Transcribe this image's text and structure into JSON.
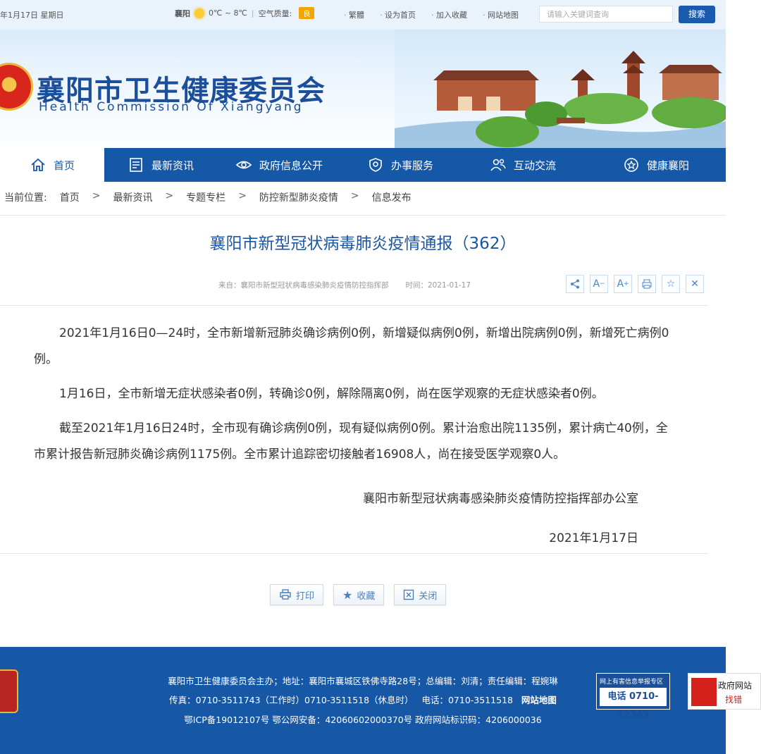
{
  "topbar": {
    "date": "年1月17日 星期日",
    "city": "襄阳",
    "temperature": "0℃ ~ 8℃",
    "air_quality_label": "空气质量:",
    "air_quality_value": "良",
    "links": [
      "繁體",
      "设为首页",
      "加入收藏",
      "网站地图"
    ],
    "search_placeholder": "请输入关键词查询",
    "search_button": "搜索"
  },
  "header": {
    "site_name_cn": "襄阳市卫生健康委员会",
    "site_name_en": "Health Commission Of Xiangyang"
  },
  "nav": {
    "items": [
      {
        "label": "首页",
        "icon": "home-icon"
      },
      {
        "label": "最新资讯",
        "icon": "news-icon"
      },
      {
        "label": "政府信息公开",
        "icon": "eye-icon"
      },
      {
        "label": "办事服务",
        "icon": "shield-icon"
      },
      {
        "label": "互动交流",
        "icon": "people-icon"
      },
      {
        "label": "健康襄阳",
        "icon": "star-badge-icon"
      }
    ]
  },
  "breadcrumb": {
    "label": "当前位置:",
    "items": [
      "首页",
      "最新资讯",
      "专题专栏",
      "防控新型肺炎疫情",
      "信息发布"
    ],
    "separator": ">"
  },
  "article": {
    "title": "襄阳市新型冠状病毒肺炎疫情通报（362）",
    "source": "来自：襄阳市新型冠状病毒感染肺炎疫情防控指挥部",
    "time": "时间：2021-01-17",
    "paragraphs": [
      "2021年1月16日0—24时，全市新增新冠肺炎确诊病例0例，新增疑似病例0例，新增出院病例0例，新增死亡病例0例。",
      "1月16日，全市新增无症状感染者0例，转确诊0例，解除隔离0例，尚在医学观察的无症状感染者0例。",
      "截至2021年1月16日24时，全市现有确诊病例0例，现有疑似病例0例。累计治愈出院1135例，累计病亡40例，全市累计报告新冠肺炎确诊病例1175例。全市累计追踪密切接触者16908人，尚在接受医学观察0人。"
    ],
    "signature": "襄阳市新型冠状病毒感染肺炎疫情防控指挥部办公室",
    "date": "2021年1月17日"
  },
  "tools": [
    "share-icon",
    "font-decrease-icon",
    "font-increase-icon",
    "print-icon",
    "favorite-icon",
    "close-icon"
  ],
  "actions": {
    "print": "打印",
    "favorite": "收藏",
    "close": "关闭"
  },
  "footer": {
    "line1": "襄阳市卫生健康委员会主办；地址：襄阳市襄城区铁佛寺路28号；总编辑：刘清；责任编辑：程婉琳",
    "fax": "传真：0710-3511743（工作时）0710-3511518（休息时）",
    "phone": "电话：0710-3511518",
    "sitemap": "网站地图",
    "line3": "鄂ICP备19012107号 鄂公网安备：42060602000370号 政府网站标识码：4206000036",
    "report_title": "网上有害信息举报专区",
    "report_phone": "电话 0710-12345",
    "gov_label": "政府网站",
    "gov_action": "找错"
  },
  "colors": {
    "brand_blue": "#1658a8",
    "title_blue": "#1b56a6",
    "accent_orange": "#f0a500"
  }
}
